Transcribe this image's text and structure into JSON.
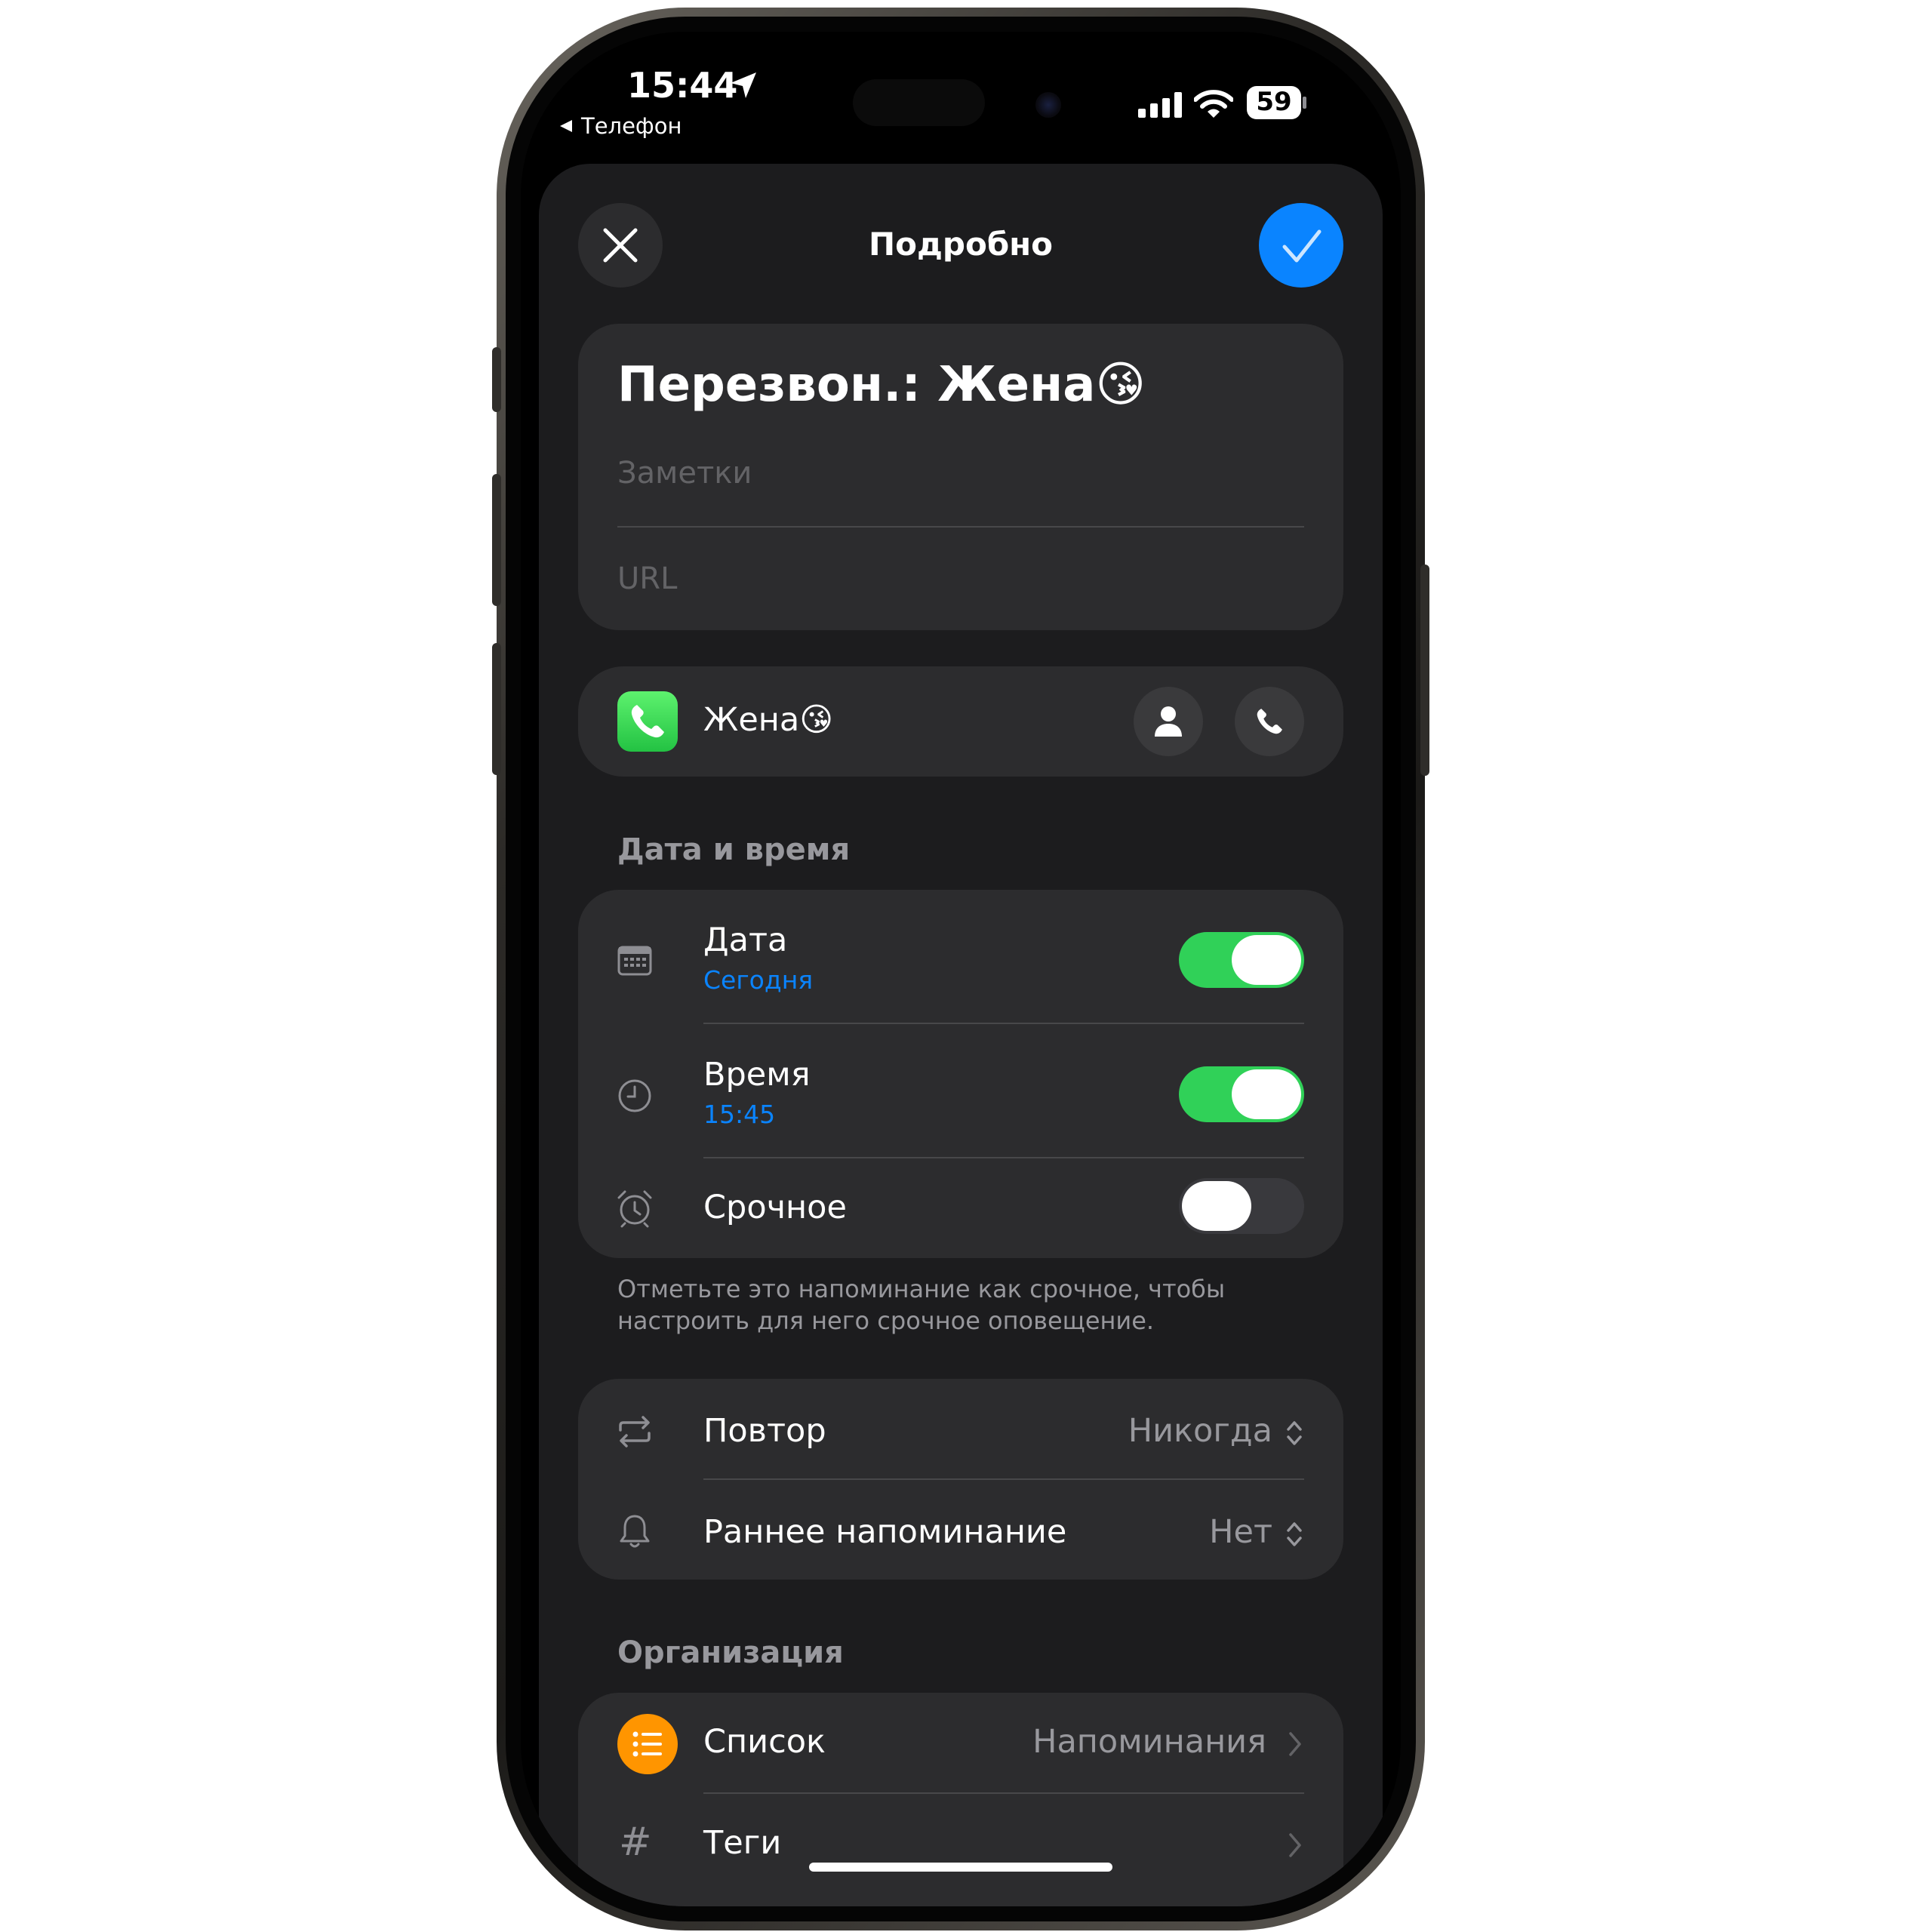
{
  "status_bar": {
    "time": "15:44",
    "back_app": "Телефон",
    "battery": "59"
  },
  "header": {
    "title": "Подробно"
  },
  "reminder": {
    "title": "Перезвон.: Жена",
    "title_emoji": "😘",
    "notes_placeholder": "Заметки",
    "url_placeholder": "URL"
  },
  "contact": {
    "name": "Жена",
    "emoji": "😘"
  },
  "date_time": {
    "section_title": "Дата и время",
    "date": {
      "label": "Дата",
      "value": "Сегодня",
      "enabled": true
    },
    "time": {
      "label": "Время",
      "value": "15:45",
      "enabled": true
    },
    "urgent": {
      "label": "Срочное",
      "enabled": false
    },
    "footer": "Отметьте это напоминание как срочное, чтобы настроить для него срочное оповещение."
  },
  "repeat": {
    "label": "Повтор",
    "value": "Никогда",
    "early_label": "Раннее напоминание",
    "early_value": "Нет"
  },
  "organization": {
    "section_title": "Организация",
    "list_label": "Список",
    "list_value": "Напоминания",
    "tags_label": "Теги"
  },
  "icons": {
    "close": "close-icon",
    "confirm": "checkmark-icon",
    "phone_app": "phone-icon",
    "contact": "person-icon",
    "call": "phone-icon",
    "calendar": "calendar-icon",
    "clock": "clock-icon",
    "alarm": "alarm-icon",
    "repeat": "repeat-icon",
    "bell": "bell-icon",
    "list": "list-icon",
    "hashtag": "hashtag-icon"
  },
  "colors": {
    "accent": "#0a84ff",
    "toggle_on": "#30d158",
    "list_orange": "#ff9500",
    "background": "#1c1c1e",
    "card": "#2c2c2e"
  }
}
